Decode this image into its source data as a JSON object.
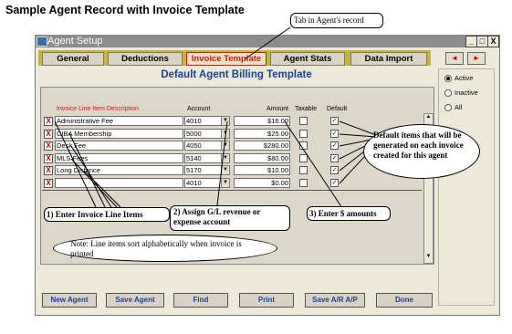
{
  "page_title": "Sample Agent Record with Invoice Template",
  "window": {
    "title": "Agent Setup",
    "controls": {
      "minimize": "_",
      "restore": "□",
      "close": "X"
    }
  },
  "tabs": [
    {
      "label": "General"
    },
    {
      "label": "Deductions"
    },
    {
      "label": "Invoice Template"
    },
    {
      "label": "Agent Stats"
    },
    {
      "label": "Data Import"
    }
  ],
  "nav": {
    "prev": "◄",
    "next": "►"
  },
  "filter": {
    "options": [
      {
        "label": "Active",
        "selected": true
      },
      {
        "label": "Inactive",
        "selected": false
      },
      {
        "label": "All",
        "selected": false
      }
    ]
  },
  "main": {
    "heading": "Default Agent Billing Template",
    "columns": {
      "description": "Invoice Line Item Description",
      "account": "Account",
      "amount": "Amount",
      "taxable": "Taxable",
      "default": "Default"
    },
    "rows": [
      {
        "description": "Administrative Fee",
        "account": "4010",
        "amount": "$16.00",
        "taxable": false,
        "default": true
      },
      {
        "description": "CIBA Membership",
        "account": "5000",
        "amount": "$25.00",
        "taxable": false,
        "default": true
      },
      {
        "description": "Desk Fee",
        "account": "4050",
        "amount": "$280.00",
        "taxable": false,
        "default": true
      },
      {
        "description": "MLS Fees",
        "account": "5140",
        "amount": "$80.00",
        "taxable": false,
        "default": true
      },
      {
        "description": "Long Distance",
        "account": "5170",
        "amount": "$10.00",
        "taxable": false,
        "default": true
      },
      {
        "description": "",
        "account": "4010",
        "amount": "$0.00",
        "taxable": false,
        "default": true
      }
    ],
    "delete_glyph": "X",
    "check_glyph": "✓",
    "dropdown_glyph": "▼"
  },
  "buttons": [
    {
      "label": "New Agent"
    },
    {
      "label": "Save Agent"
    },
    {
      "label": "Find"
    },
    {
      "label": "Print"
    },
    {
      "label": "Save A/R A/P"
    },
    {
      "label": "Done"
    }
  ],
  "callouts": {
    "tab": "Tab in Agent's record",
    "line_items": "1) Enter Invoice Line Items",
    "gl": "2) Assign G/L revenue or expense account",
    "amounts": "3) Enter $ amounts",
    "default_items": "Default items that will be generated on each invoice created for this agent",
    "note": "Note: Line items sort alphabetically when invoice is printed"
  },
  "colors": {
    "accent_red": "#d2141c",
    "heading_blue": "#1f3e9a",
    "tab_bar_gold": "#c9b43a"
  }
}
